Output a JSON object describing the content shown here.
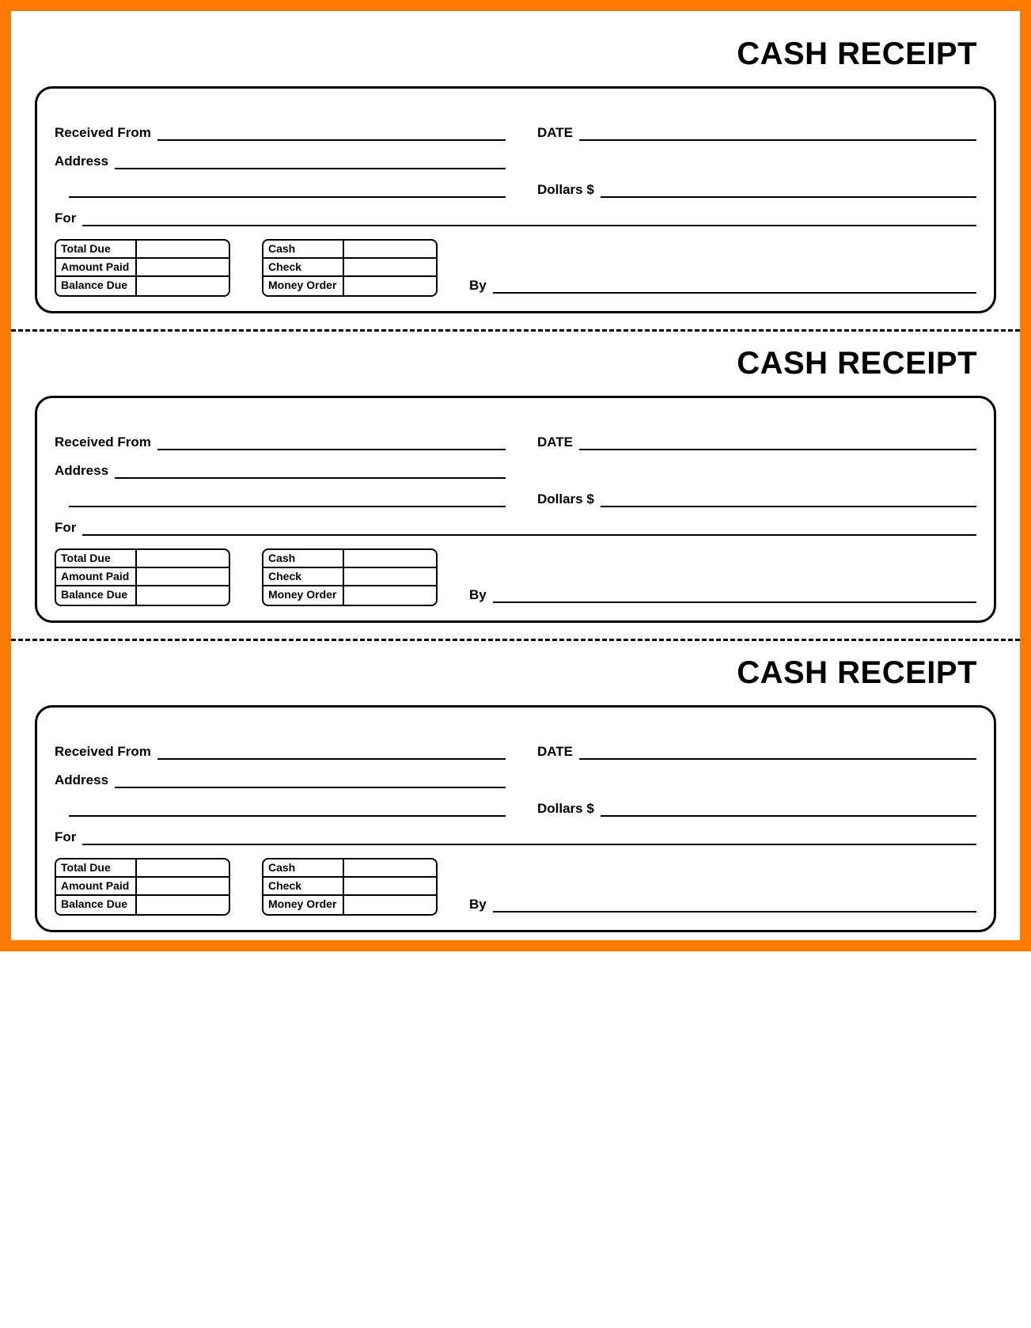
{
  "title": "CASH RECEIPT",
  "labels": {
    "received_from": "Received From",
    "address": "Address",
    "date": "DATE",
    "dollars": "Dollars $",
    "for": "For",
    "by": "By"
  },
  "totals": {
    "total_due": "Total Due",
    "amount_paid": "Amount Paid",
    "balance_due": "Balance Due"
  },
  "payment": {
    "cash": "Cash",
    "check": "Check",
    "money_order": "Money Order"
  },
  "receipt_count": 3
}
